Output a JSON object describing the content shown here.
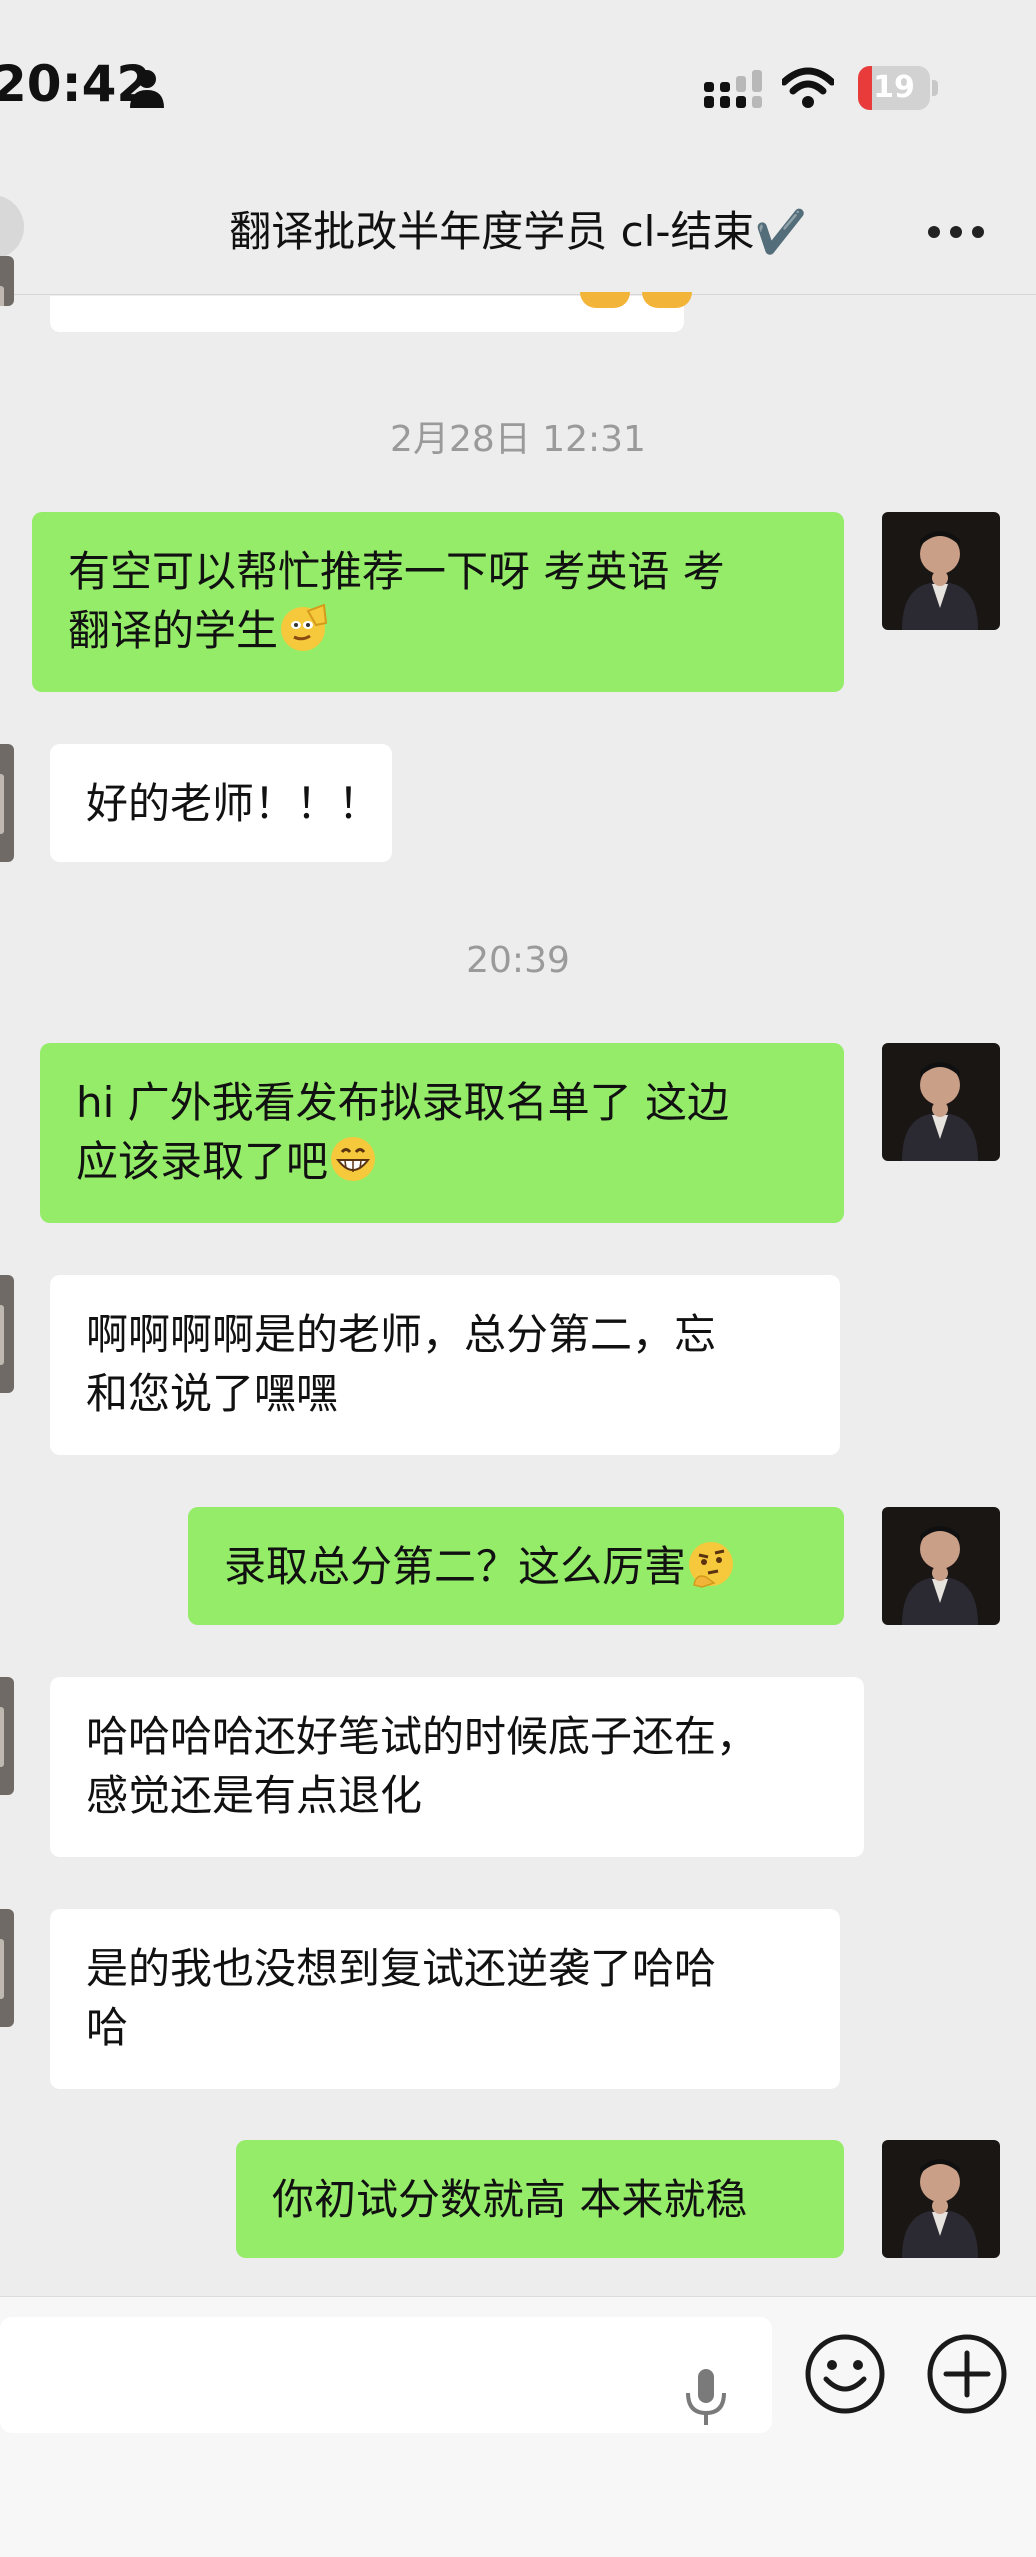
{
  "status_bar": {
    "time": "20:42",
    "battery": "19",
    "battery_level": 0.19
  },
  "nav": {
    "title": "翻译批改半年度学员 cl-结束✔️"
  },
  "timestamps": [
    "2月28日 12:31",
    "20:39"
  ],
  "messages": [
    {
      "sender": "self",
      "lines": [
        "有空可以帮忙推荐一下呀 考英语 考",
        "翻译的学生"
      ],
      "emoji": "salute"
    },
    {
      "sender": "other",
      "lines": [
        "好的老师！！！"
      ]
    },
    {
      "sender": "self",
      "lines": [
        "hi 广外我看发布拟录取名单了 这边",
        "应该录取了吧"
      ],
      "emoji": "grin"
    },
    {
      "sender": "other",
      "lines": [
        "啊啊啊啊是的老师，总分第二，忘",
        "和您说了嘿嘿"
      ]
    },
    {
      "sender": "self",
      "lines": [
        "录取总分第二？这么厉害"
      ],
      "emoji": "thinking"
    },
    {
      "sender": "other",
      "lines": [
        "哈哈哈哈还好笔试的时候底子还在，",
        "感觉还是有点退化"
      ]
    },
    {
      "sender": "other",
      "lines": [
        "是的我也没想到复试还逆袭了哈哈",
        "哈"
      ]
    },
    {
      "sender": "self",
      "lines": [
        "你初试分数就高 本来就稳"
      ]
    }
  ],
  "colors": {
    "self_bubble": "#95ec69",
    "other_bubble": "#ffffff",
    "background": "#ededed"
  },
  "input_bar": {
    "placeholder": ""
  }
}
